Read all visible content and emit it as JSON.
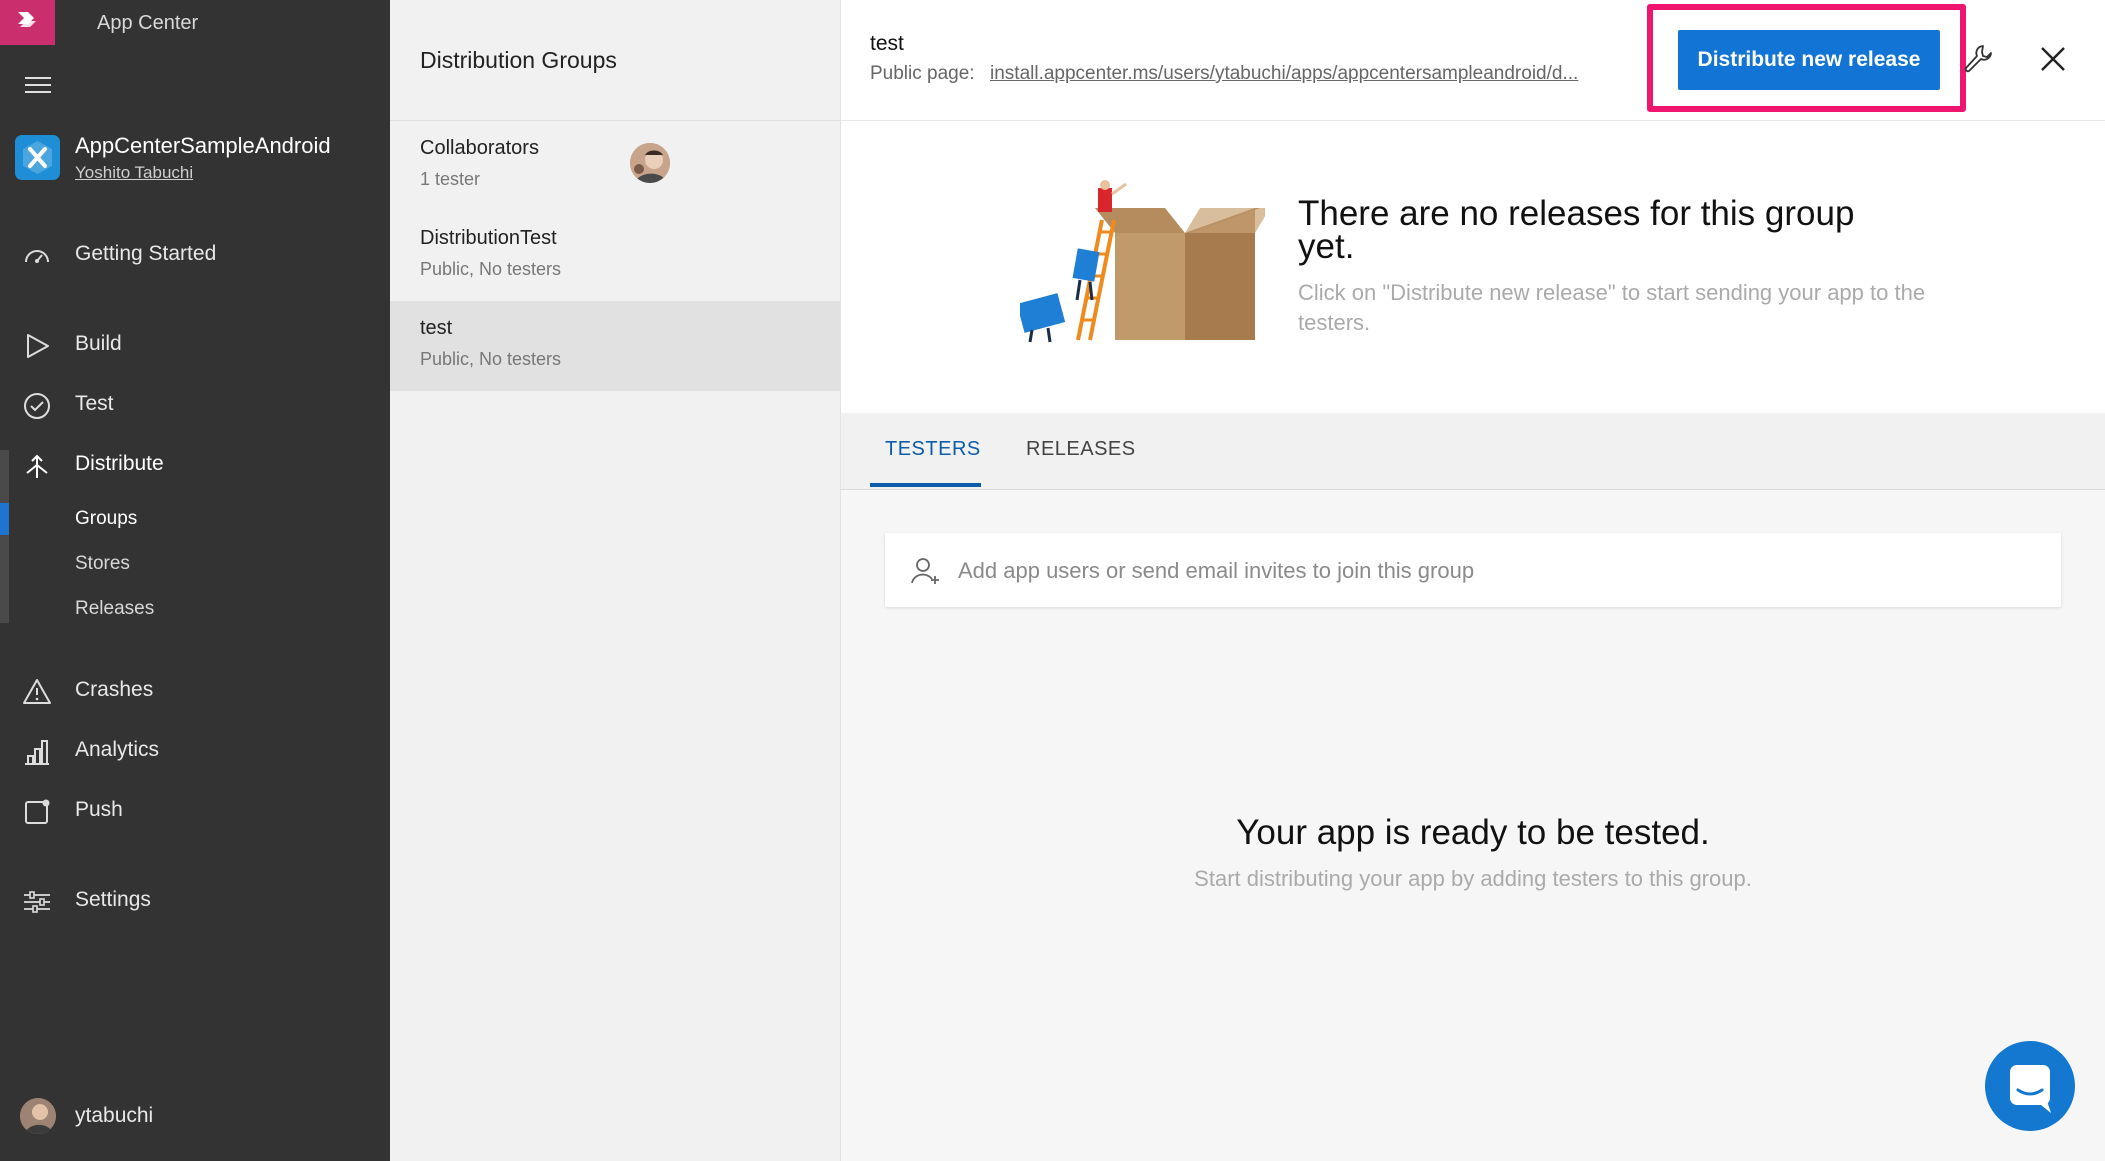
{
  "app": {
    "name": "App Center"
  },
  "sidebar": {
    "app_title": "AppCenterSampleAndroid",
    "app_owner": "Yoshito Tabuchi",
    "nav": [
      {
        "label": "Getting Started",
        "icon": "dashboard-icon"
      },
      {
        "label": "Build",
        "icon": "play-icon"
      },
      {
        "label": "Test",
        "icon": "check-circle-icon"
      },
      {
        "label": "Distribute",
        "icon": "distribute-icon"
      },
      {
        "label": "Crashes",
        "icon": "warning-icon"
      },
      {
        "label": "Analytics",
        "icon": "bar-chart-icon"
      },
      {
        "label": "Push",
        "icon": "push-icon"
      },
      {
        "label": "Settings",
        "icon": "sliders-icon"
      }
    ],
    "distribute_sub": [
      {
        "label": "Groups",
        "active": true
      },
      {
        "label": "Stores",
        "active": false
      },
      {
        "label": "Releases",
        "active": false
      }
    ],
    "user_name": "ytabuchi"
  },
  "groups": {
    "title": "Distribution Groups",
    "items": [
      {
        "name": "Collaborators",
        "sub": "1 tester",
        "selected": false
      },
      {
        "name": "DistributionTest",
        "sub": "Public, No testers",
        "selected": false
      },
      {
        "name": "test",
        "sub": "Public, No testers",
        "selected": true
      }
    ]
  },
  "detail": {
    "group_title": "test",
    "public_label": "Public page:",
    "public_link": "install.appcenter.ms/users/ytabuchi/apps/appcentersampleandroid/d...",
    "distribute_button": "Distribute new release",
    "empty_title": "There are no releases for this group yet.",
    "empty_sub": "Click on \"Distribute new release\" to start sending your app to the testers.",
    "tabs": [
      {
        "label": "TESTERS",
        "active": true
      },
      {
        "label": "RELEASES",
        "active": false
      }
    ],
    "invite_placeholder": "Add app users or send email invites to join this group",
    "ready_title": "Your app is ready to be tested.",
    "ready_sub": "Start distributing your app by adding testers to this group."
  },
  "colors": {
    "brand": "#cb2e6d",
    "sidebar_bg": "#333333",
    "accent": "#1275d6",
    "highlight": "#f0156f"
  }
}
